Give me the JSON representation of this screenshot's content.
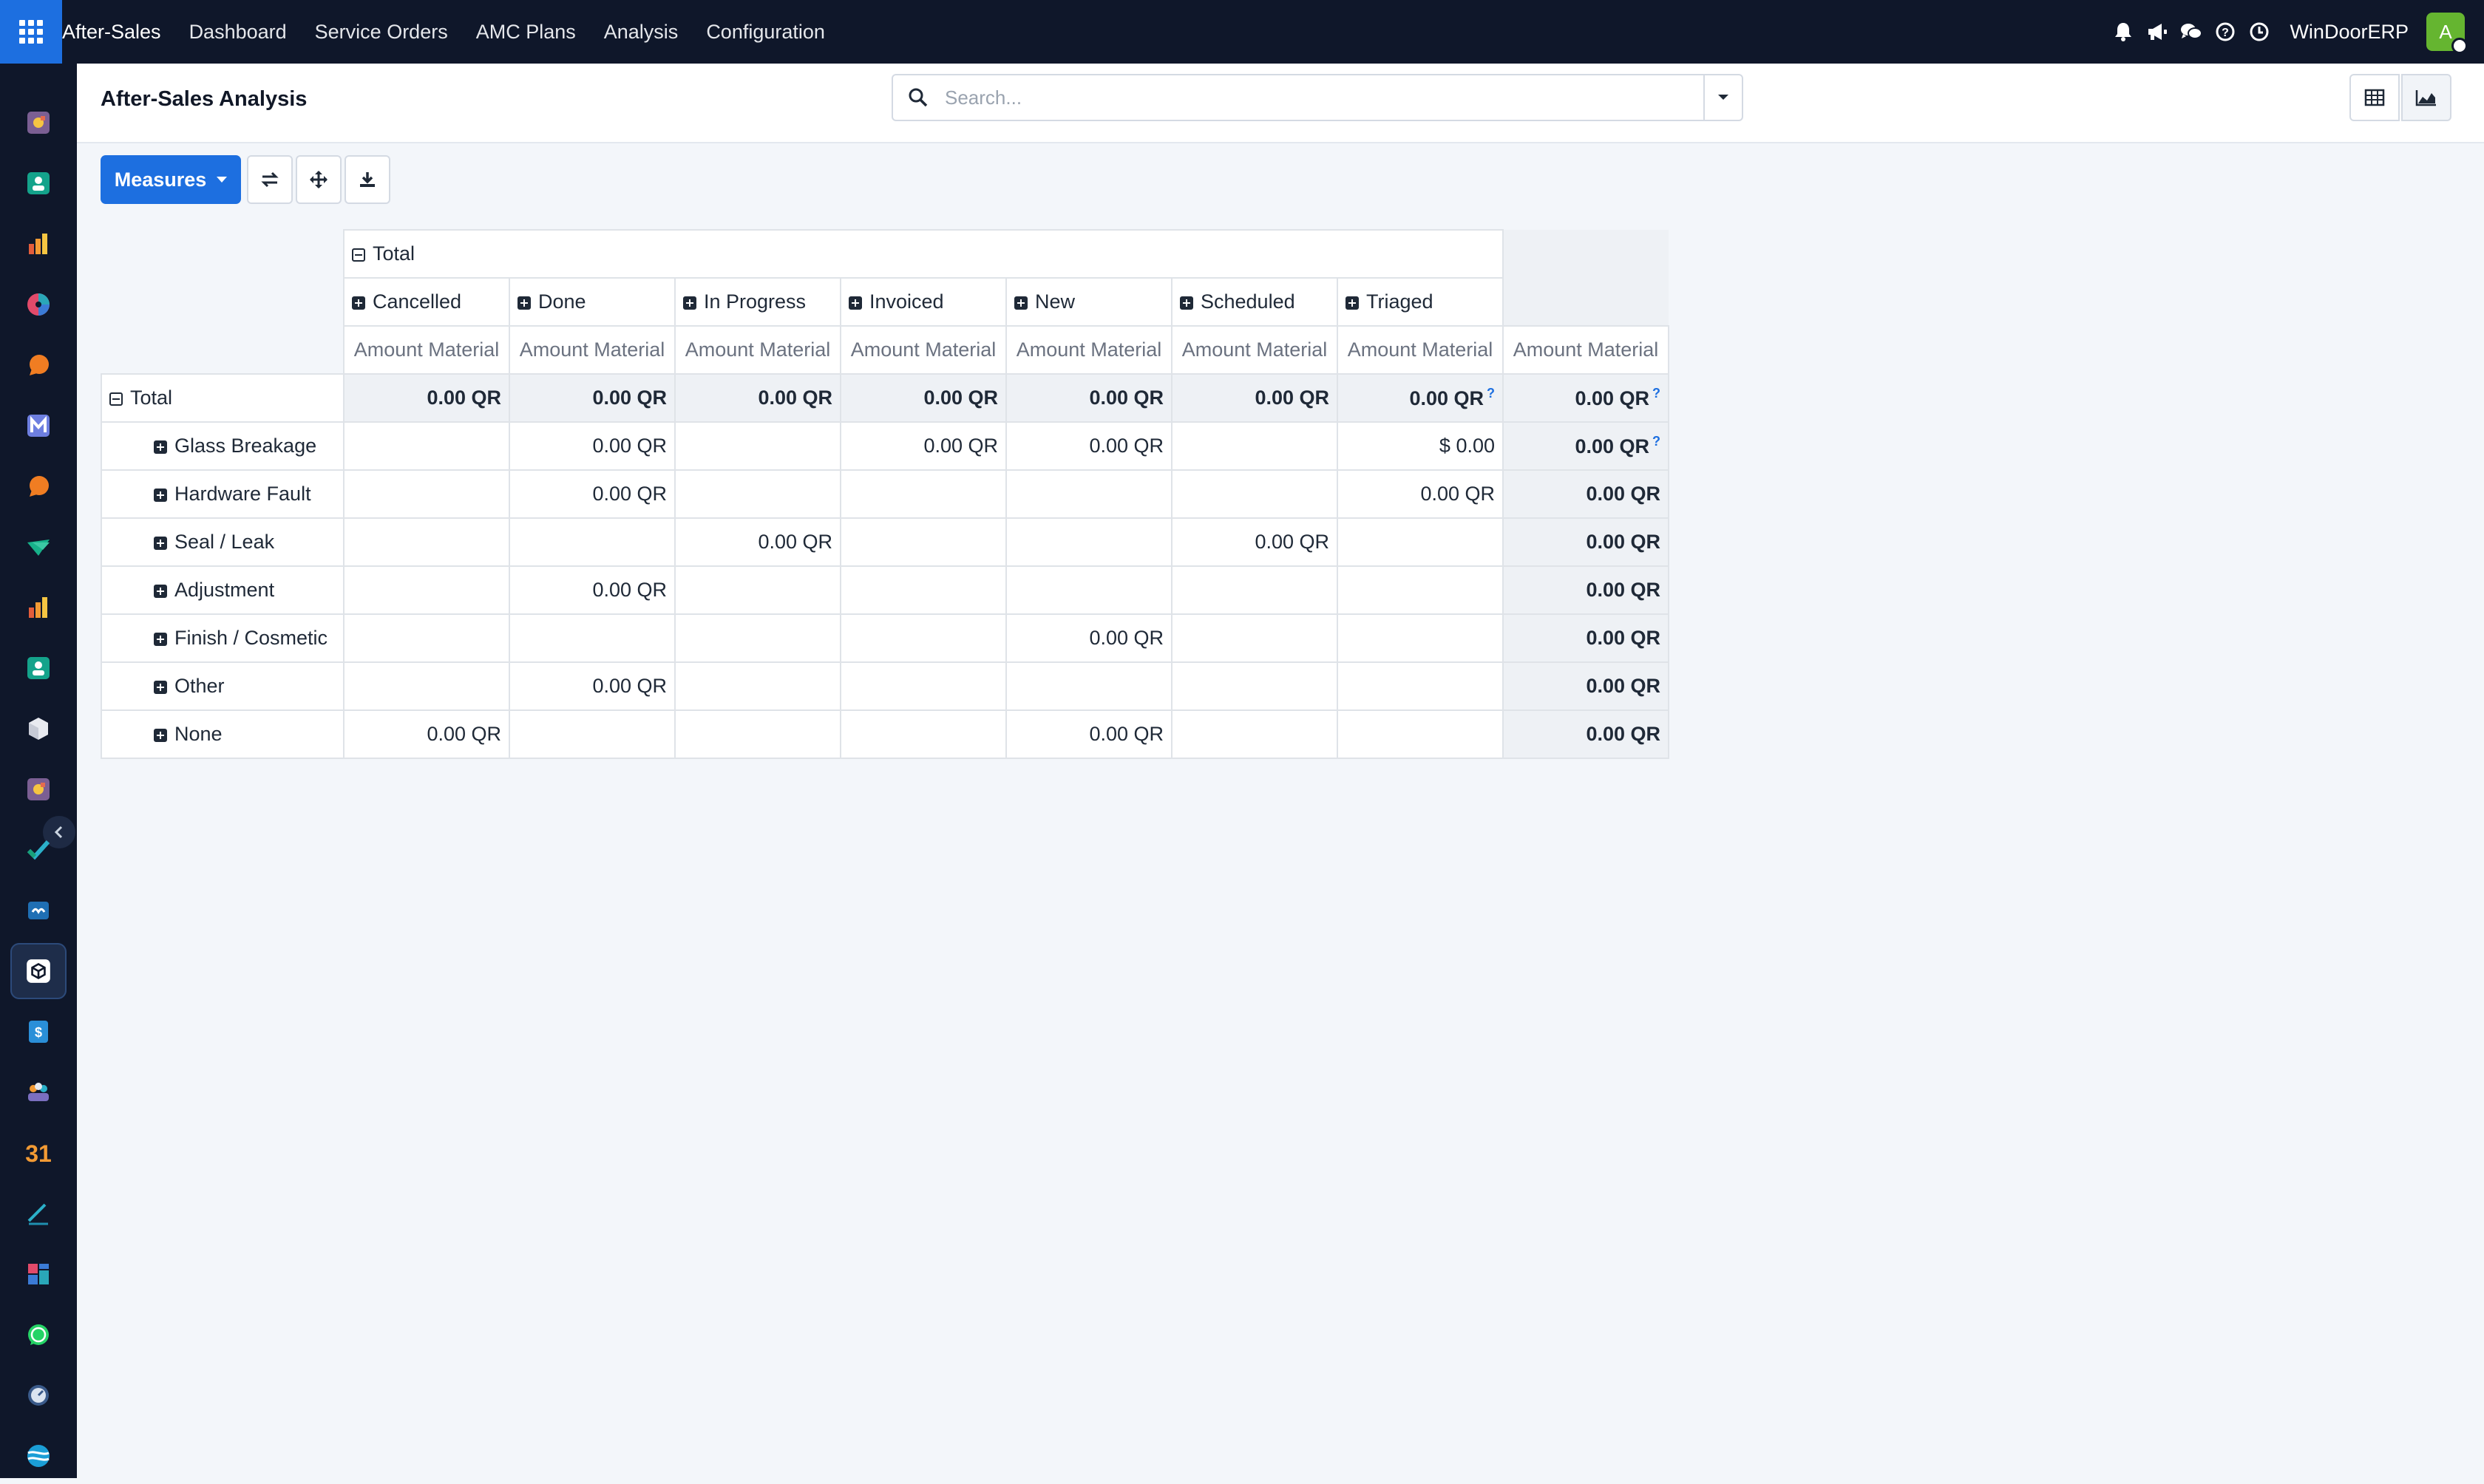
{
  "navbar": {
    "app_name": "After-Sales",
    "menu": [
      "Dashboard",
      "Service Orders",
      "AMC Plans",
      "Analysis",
      "Configuration"
    ],
    "company": "WinDoorERP",
    "avatar_initial": "A",
    "icons": [
      "bell-icon",
      "megaphone-icon",
      "chat-icon",
      "help-icon",
      "clock-icon"
    ]
  },
  "sidebar": {
    "apps": [
      "discuss",
      "contacts",
      "reports",
      "crm",
      "chat",
      "mail",
      "livechat",
      "project",
      "analytics",
      "employees",
      "inventory",
      "discuss-alt",
      "todo",
      "knowledge",
      "after-sales",
      "accounting",
      "team",
      "calendar",
      "sign",
      "dashboards",
      "whatsapp",
      "timer",
      "website"
    ],
    "active_app": "after-sales"
  },
  "control_panel": {
    "title": "After-Sales Analysis",
    "search_placeholder": "Search..."
  },
  "toolbar": {
    "measures_label": "Measures"
  },
  "pivot": {
    "total_header": "Total",
    "measure": "Amount Material",
    "columns": [
      "Cancelled",
      "Done",
      "In Progress",
      "Invoiced",
      "New",
      "Scheduled",
      "Triaged"
    ],
    "total_row": {
      "label": "Total",
      "values": [
        "0.00 QR",
        "0.00 QR",
        "0.00 QR",
        "0.00 QR",
        "0.00 QR",
        "0.00 QR",
        "0.00 QR"
      ],
      "total": "0.00 QR"
    },
    "rows": [
      {
        "label": "Glass Breakage",
        "values": [
          "",
          "0.00 QR",
          "",
          "0.00 QR",
          "0.00 QR",
          "",
          "$ 0.00"
        ],
        "total": "0.00 QR"
      },
      {
        "label": "Hardware Fault",
        "values": [
          "",
          "0.00 QR",
          "",
          "",
          "",
          "",
          "0.00 QR"
        ],
        "total": "0.00 QR"
      },
      {
        "label": "Seal / Leak",
        "values": [
          "",
          "",
          "0.00 QR",
          "",
          "",
          "0.00 QR",
          ""
        ],
        "total": "0.00 QR"
      },
      {
        "label": "Adjustment",
        "values": [
          "",
          "0.00 QR",
          "",
          "",
          "",
          "",
          ""
        ],
        "total": "0.00 QR"
      },
      {
        "label": "Finish / Cosmetic",
        "values": [
          "",
          "",
          "",
          "",
          "0.00 QR",
          "",
          ""
        ],
        "total": "0.00 QR"
      },
      {
        "label": "Other",
        "values": [
          "",
          "0.00 QR",
          "",
          "",
          "",
          "",
          ""
        ],
        "total": "0.00 QR"
      },
      {
        "label": "None",
        "values": [
          "0.00 QR",
          "",
          "",
          "",
          "0.00 QR",
          "",
          ""
        ],
        "total": "0.00 QR"
      }
    ],
    "mixed_currency_marker": "?"
  }
}
